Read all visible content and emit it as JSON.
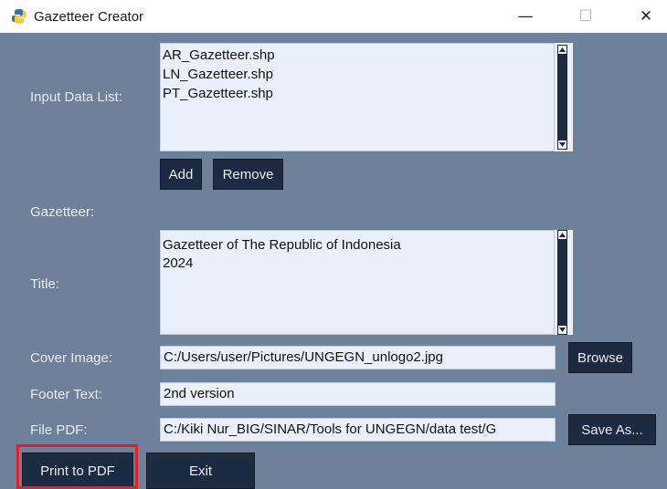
{
  "window": {
    "title": "Gazetteer Creator",
    "min_glyph": "—",
    "max_glyph": "☐",
    "close_glyph": "✕"
  },
  "input_data": {
    "label": "Input Data List:",
    "items": [
      "AR_Gazetteer.shp",
      "LN_Gazetteer.shp",
      "PT_Gazetteer.shp"
    ],
    "add_label": "Add",
    "remove_label": "Remove"
  },
  "gazetteer": {
    "section_label": "Gazetteer:",
    "title_label": "Title:",
    "title_lines": [
      "Gazetteer of The Republic of Indonesia",
      "2024"
    ]
  },
  "cover_image": {
    "label": "Cover Image:",
    "value": "C:/Users/user/Pictures/UNGEGN_unlogo2.jpg",
    "browse_label": "Browse"
  },
  "footer_text": {
    "label": "Footer Text:",
    "value": "2nd version"
  },
  "file_pdf": {
    "label": "File PDF:",
    "value": "C:/Kiki Nur_BIG/SINAR/Tools for UNGEGN/data test/G",
    "save_as_label": "Save As..."
  },
  "actions": {
    "print_label": "Print to PDF",
    "exit_label": "Exit"
  },
  "colors": {
    "background": "#6d819b",
    "button": "#1c2a42",
    "field": "#eaf0f9",
    "highlight": "#e3202a"
  }
}
